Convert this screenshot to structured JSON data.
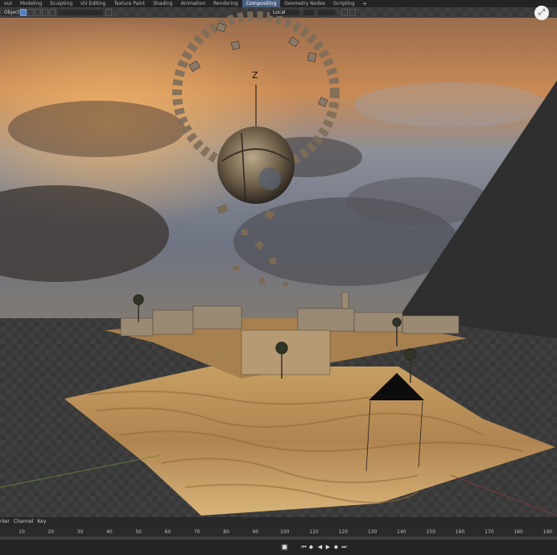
{
  "workspace_tabs": [
    "out",
    "Modeling",
    "Sculpting",
    "UV Editing",
    "Texture Paint",
    "Shading",
    "Animation",
    "Rendering",
    "Compositing",
    "Geometry Nodes",
    "Scripting"
  ],
  "active_tab": "Compositing",
  "add_tab_label": "+",
  "viewport_header": {
    "mode_label": "Object",
    "transform_orientation": "Local",
    "axis_label": "Z"
  },
  "icons": {
    "maximize": "maximize-icon",
    "play": "play-icon"
  },
  "timeline": {
    "menu": [
      "rker",
      "Channel",
      "Key"
    ],
    "ticks": [
      "10",
      "20",
      "30",
      "40",
      "50",
      "60",
      "70",
      "80",
      "90",
      "100",
      "110",
      "120",
      "130",
      "140",
      "150",
      "160",
      "170",
      "180",
      "190"
    ]
  },
  "colors": {
    "header_bg": "#232323",
    "active_tab": "#4a5f80",
    "sand": "#c9a36a",
    "sky": "#7d8da0"
  }
}
